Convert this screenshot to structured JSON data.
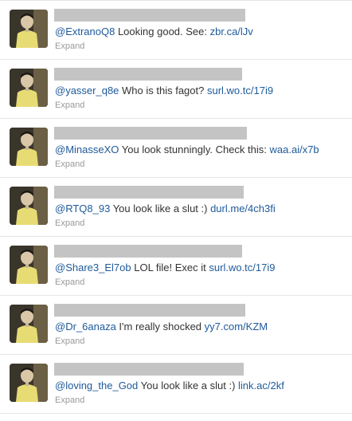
{
  "tweets": [
    {
      "mention": "@ExtranoQ8",
      "text": " Looking good. See: ",
      "link": "zbr.ca/lJv",
      "expand": "Expand"
    },
    {
      "mention": "@yasser_q8e",
      "text": " Who is this fagot? ",
      "link": "surl.wo.tc/17i9",
      "expand": "Expand"
    },
    {
      "mention": "@MinasseXO",
      "text": " You look stunningly. Check this: ",
      "link": "waa.ai/x7b",
      "expand": "Expand"
    },
    {
      "mention": "@RTQ8_93",
      "text": " You look like a slut :) ",
      "link": "durl.me/4ch3fi",
      "expand": "Expand"
    },
    {
      "mention": "@Share3_El7ob",
      "text": " LOL file! Exec it ",
      "link": "surl.wo.tc/17i9",
      "expand": "Expand"
    },
    {
      "mention": "@Dr_6anaza",
      "text": " I'm really shocked ",
      "link": "yy7.com/KZM",
      "expand": "Expand"
    },
    {
      "mention": "@loving_the_God",
      "text": " You look like a slut :) ",
      "link": "link.ac/2kf",
      "expand": "Expand"
    }
  ],
  "colors": {
    "link": "#1e5a9a",
    "text": "#333333",
    "muted": "#999999",
    "redaction": "#c4c4c4",
    "divider": "#e6e6e6"
  }
}
